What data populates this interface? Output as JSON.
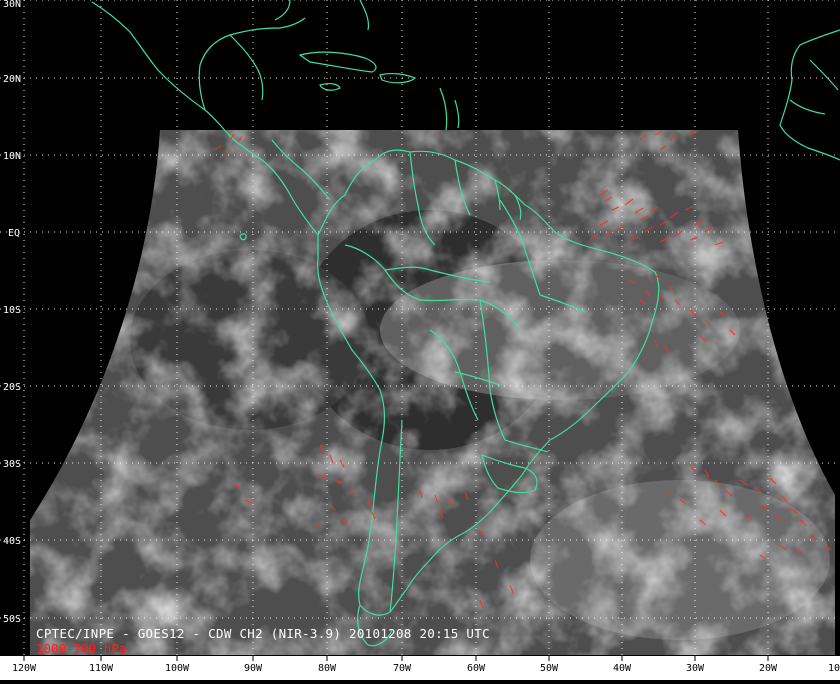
{
  "map": {
    "caption": "CPTEC/INPE - GOES12 - CDW CH2 (NIR-3.9) 20101208 20:15 UTC",
    "level_label": "1000-700 hPa",
    "lat_labels": [
      "30N",
      "20N",
      "10N",
      "EQ",
      "10S",
      "20S",
      "30S",
      "40S",
      "50S"
    ],
    "lon_labels": [
      "120W",
      "110W",
      "100W",
      "90W",
      "80W",
      "70W",
      "60W",
      "50W",
      "40W",
      "30W",
      "20W",
      "10"
    ],
    "colors": {
      "background": "#000000",
      "coastline": "#3fe0a0",
      "wind_vectors": "#ff2a2a",
      "grid": "#ffffff",
      "caption": "#ffffff",
      "level_label": "#ff2020"
    }
  }
}
